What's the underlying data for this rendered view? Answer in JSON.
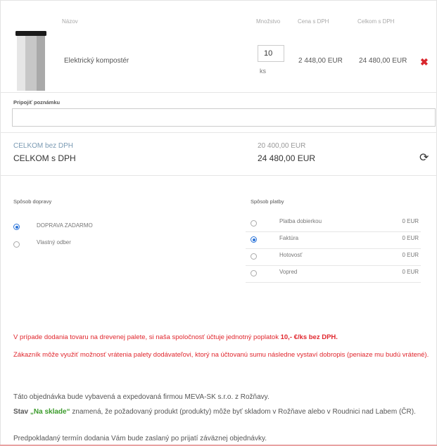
{
  "table": {
    "headers": {
      "name": "Názov",
      "quantity": "Množstvo",
      "price_vat": "Cena s DPH",
      "total_vat": "Celkom s DPH"
    },
    "item": {
      "name": "Elektrický kompostér",
      "quantity": "10",
      "unit": "ks",
      "price": "2 448,00 EUR",
      "total": "24 480,00 EUR",
      "remove_icon": "close-icon"
    }
  },
  "note": {
    "label": "Pripojiť poznámku",
    "value": ""
  },
  "totals": {
    "without_vat_label": "CELKOM bez DPH",
    "without_vat_value": "20 400,00 EUR",
    "with_vat_label": "CELKOM s DPH",
    "with_vat_value": "24 480,00 EUR",
    "refresh_icon": "refresh-icon"
  },
  "shipping": {
    "title": "Spôsob dopravy",
    "options": [
      {
        "label": "DOPRAVA ZADARMO",
        "checked": true
      },
      {
        "label": "Vlastný odber",
        "checked": false
      }
    ]
  },
  "payment": {
    "title": "Spôsob platby",
    "options": [
      {
        "label": "Platba dobierkou",
        "price": "0 EUR",
        "checked": false
      },
      {
        "label": "Faktúra",
        "price": "0 EUR",
        "checked": true
      },
      {
        "label": "Hotovosť",
        "price": "0 EUR",
        "checked": false
      },
      {
        "label": "Vopred",
        "price": "0 EUR",
        "checked": false
      }
    ]
  },
  "notices": {
    "pallet_prefix": "V prípade dodania tovaru na drevenej palete, si naša spoločnosť účtuje jednotný poplatok ",
    "pallet_fee": "10,- €/ks bez DPH.",
    "pallet_return": "Zákazník môže využiť možnosť vrátenia palety dodávateľovi, ktorý na účtovanú sumu následne vystaví dobropis (peniaze mu budú vrátené).",
    "expedition": "Táto objednávka bude vybavená a expedovaná firmou MEVA-SK s.r.o. z Rožňavy.",
    "stock_prefix": "Stav",
    "stock_value": "„Na sklade“",
    "stock_suffix": " znamená, že požadovaný produkt (produkty) môže byť skladom v Rožňave alebo v Roudnici nad Labem (ČR).",
    "delivery_term": "Predpokladaný termín dodania Vám bude zaslaný po prijatí záväznej objednávky."
  },
  "colors": {
    "accent_red": "#e0262d",
    "radio_blue": "#2a73d8",
    "stock_green": "#3a9a2a"
  }
}
